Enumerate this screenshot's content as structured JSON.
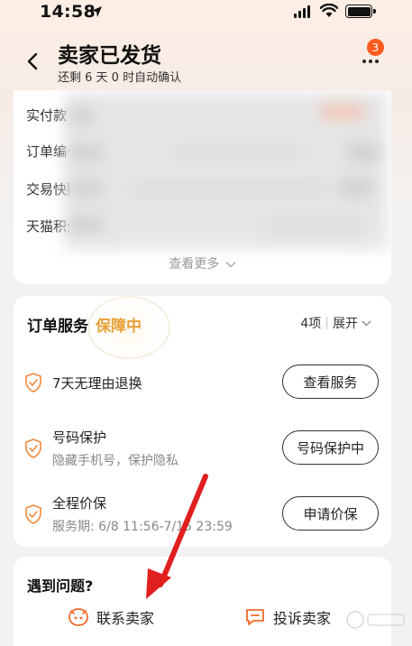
{
  "status_bar": {
    "time": "14:58"
  },
  "header": {
    "title": "卖家已发货",
    "subtitle": "还剩 6 天 0 时自动确认",
    "notification_count": "3"
  },
  "order_info": {
    "rows": [
      {
        "label": "实付款"
      },
      {
        "label": "订单编号"
      },
      {
        "label": "交易快照"
      },
      {
        "label": "天猫积分"
      }
    ],
    "see_more": "查看更多"
  },
  "services": {
    "title": "订单服务",
    "status": "保障中",
    "count": "4项",
    "expand": "展开",
    "items": [
      {
        "name": "7天无理由退换",
        "sub": "",
        "button": "查看服务"
      },
      {
        "name": "号码保护",
        "sub": "隐藏手机号，保护隐私",
        "button": "号码保护中"
      },
      {
        "name": "全程价保",
        "sub": "服务期: 6/8 11:56-7/15 23:59",
        "button": "申请价保"
      }
    ]
  },
  "problems": {
    "title": "遇到问题?",
    "contact_seller": "联系卖家",
    "complain_seller": "投诉卖家"
  },
  "colors": {
    "accent_orange": "#ff5a1f",
    "guarantee_gold": "#e8a039",
    "annotation_red": "#e01f1f"
  }
}
